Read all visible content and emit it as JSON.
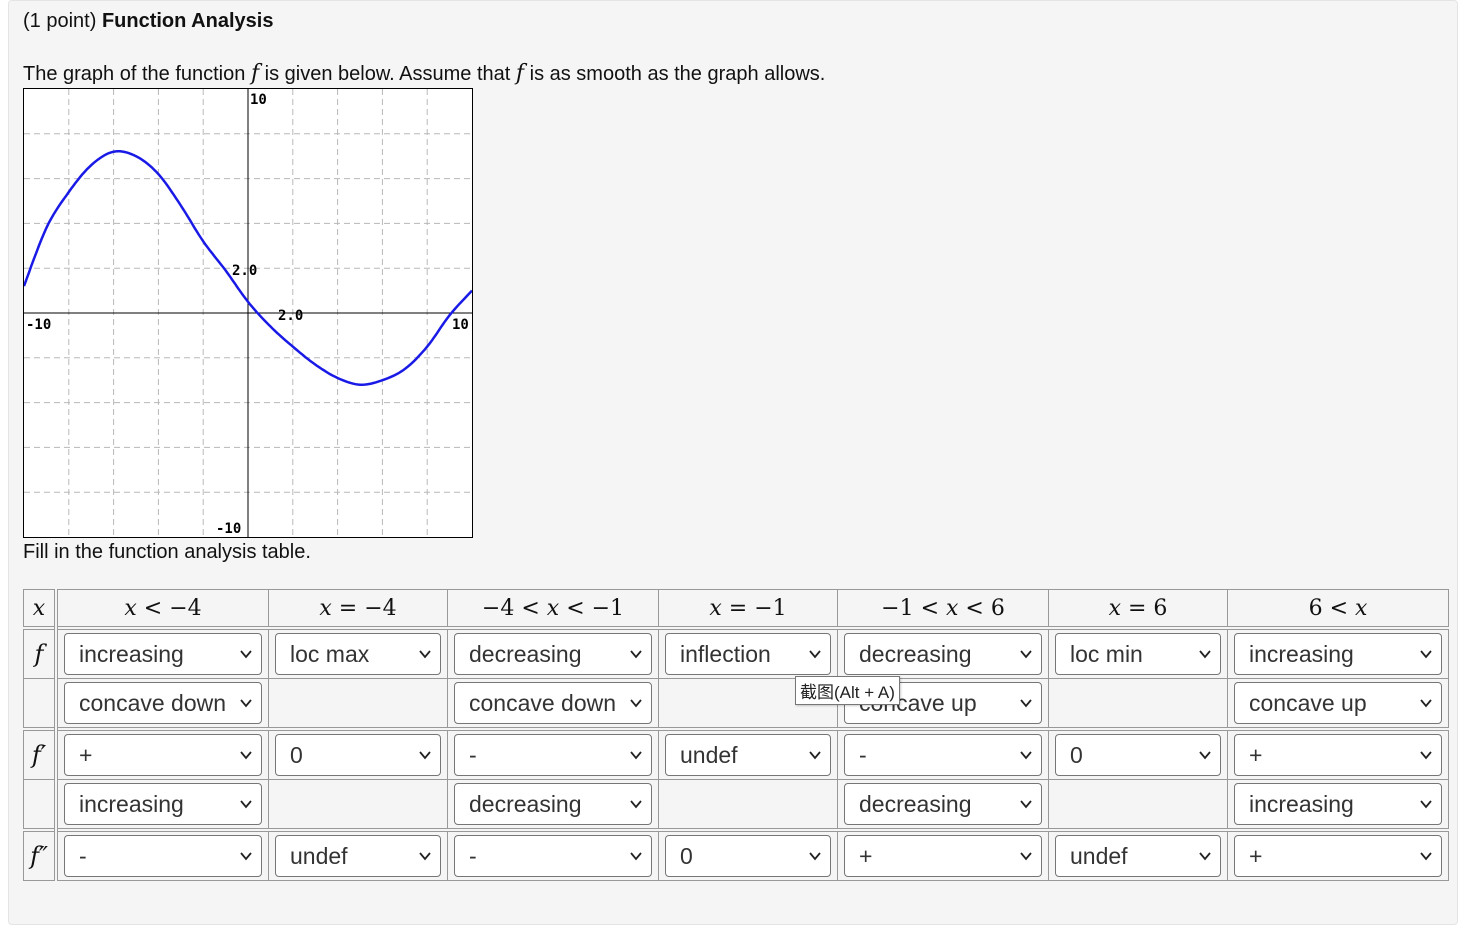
{
  "header": {
    "points": "(1 point)",
    "title": "Function Analysis"
  },
  "intro": {
    "part1": "The graph of the function ",
    "f1": "f",
    "part2": " is given below. Assume that ",
    "f2": "f",
    "part3": " is as smooth as the graph allows."
  },
  "graph": {
    "labels": {
      "ymax": "10",
      "ymin": "-10",
      "xmin": "-10",
      "xmax": "10",
      "y_mark": "2.0",
      "x_mark": "2.0"
    },
    "x_range": [
      -10,
      10
    ],
    "y_range": [
      -10,
      10
    ],
    "grid_step": 2,
    "curve_color": "#1a1ae6",
    "curve_points": [
      [
        -10,
        1.2
      ],
      [
        -9,
        3.8
      ],
      [
        -8,
        5.4
      ],
      [
        -7,
        6.6
      ],
      [
        -6,
        7.2
      ],
      [
        -5,
        7.0
      ],
      [
        -4,
        6.2
      ],
      [
        -3,
        4.8
      ],
      [
        -2,
        3.2
      ],
      [
        -1,
        1.9
      ],
      [
        0,
        0.5
      ],
      [
        1,
        -0.6
      ],
      [
        2,
        -1.5
      ],
      [
        3,
        -2.3
      ],
      [
        4,
        -2.9
      ],
      [
        5,
        -3.2
      ],
      [
        6,
        -3.0
      ],
      [
        7,
        -2.5
      ],
      [
        8,
        -1.5
      ],
      [
        9,
        -0.1
      ],
      [
        10,
        1.0
      ]
    ]
  },
  "instruction": "Fill in the function analysis table.",
  "table": {
    "headers": [
      "x",
      "x < −4",
      "x = −4",
      "−4 < x < −1",
      "x = −1",
      "−1 < x < 6",
      "x = 6",
      "6 < x"
    ],
    "row_labels": {
      "f": "f",
      "fp": "f′",
      "fpp": "f″"
    },
    "f_row1": [
      "increasing",
      "loc max",
      "decreasing",
      "inflection",
      "decreasing",
      "loc min",
      "increasing"
    ],
    "f_row2": [
      "concave down",
      "",
      "concave down",
      "",
      "concave up",
      "",
      "concave up"
    ],
    "fp_row1": [
      "+",
      "0",
      "-",
      "undef",
      "-",
      "0",
      "+"
    ],
    "fp_row2": [
      "increasing",
      "",
      "decreasing",
      "",
      "decreasing",
      "",
      "increasing"
    ],
    "fpp_row1": [
      "-",
      "undef",
      "-",
      "0",
      "+",
      "undef",
      "+"
    ]
  },
  "tooltip": "截图(Alt + A)"
}
